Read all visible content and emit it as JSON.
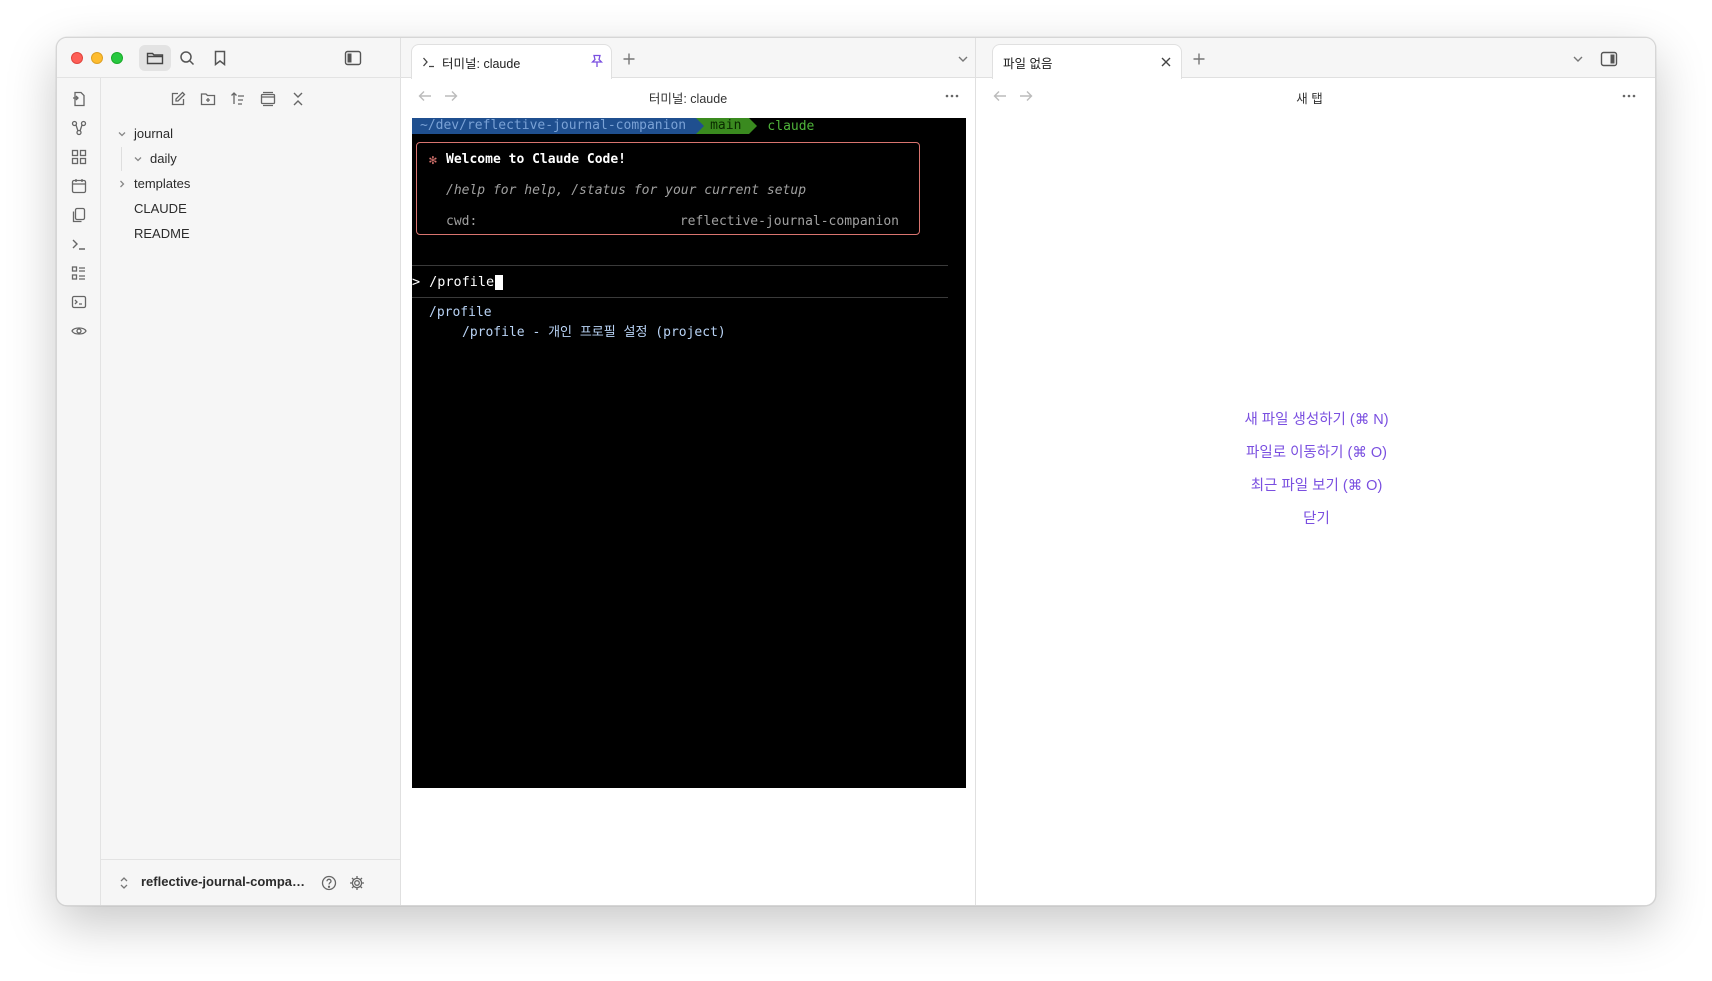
{
  "sidebar": {
    "tree": [
      {
        "label": "journal"
      },
      {
        "label": "daily"
      },
      {
        "label": "templates"
      },
      {
        "label": "CLAUDE"
      },
      {
        "label": "README"
      }
    ],
    "vault_name": "reflective-journal-compani..."
  },
  "middle_pane": {
    "tab_label": "터미널: claude",
    "view_title": "터미널: claude",
    "terminal": {
      "prompt_path": "~/dev/reflective-journal-companion",
      "prompt_branch": " main",
      "prompt_command": "claude",
      "welcome_star": "✻",
      "welcome_title": "Welcome to Claude Code!",
      "welcome_help": "/help for help, /status for your current setup",
      "cwd_label": "cwd:",
      "cwd_value": "reflective-journal-companion",
      "input_prefix": ">",
      "input_text": "/profile",
      "suggestion_name": "/profile",
      "suggestion_desc": "/profile - 개인 프로필 설정 (project)"
    }
  },
  "right_pane": {
    "tab_label": "파일 없음",
    "view_title": "새 탭",
    "actions": [
      "새 파일 생성하기 (⌘ N)",
      "파일로 이동하기 (⌘ O)",
      "최근 파일 보기 (⌘ O)",
      "닫기"
    ]
  },
  "colors": {
    "accent": "#7a4fe0",
    "terminal_bg": "#000000",
    "welcome_border": "#d9746f"
  },
  "icons": {
    "titlebar": [
      "folder-icon",
      "search-icon",
      "bookmark-icon",
      "sidebar-toggle-icon"
    ],
    "ribbon": [
      "quick-switcher-icon",
      "graph-icon",
      "canvas-icon",
      "calendar-icon",
      "copy-icon",
      "terminal-icon",
      "list-icon",
      "command-icon",
      "eye-icon"
    ],
    "explorer_toolbar": [
      "new-note-icon",
      "new-folder-icon",
      "sort-icon",
      "collapse-view-icon",
      "collapse-all-icon"
    ]
  }
}
